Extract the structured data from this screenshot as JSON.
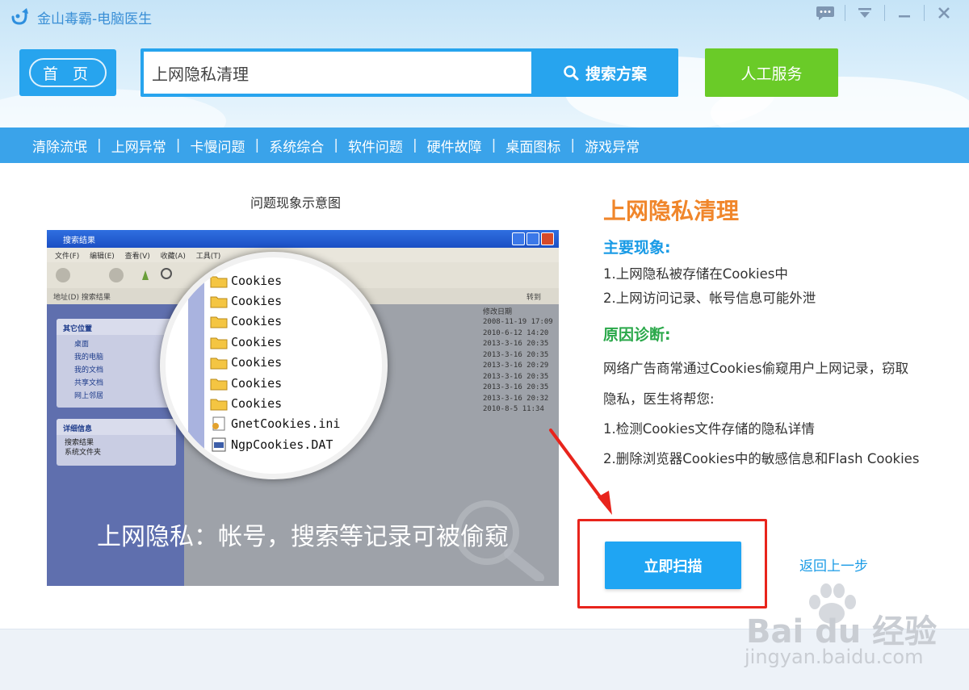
{
  "window": {
    "title": "金山毒霸-电脑医生",
    "brand_color": "#27a4ee"
  },
  "header": {
    "home_label": "首 页",
    "search_value": "上网隐私清理",
    "search_button": "搜索方案",
    "human_service": "人工服务"
  },
  "categories": [
    "清除流氓",
    "上网异常",
    "卡慢问题",
    "系统综合",
    "软件问题",
    "硬件故障",
    "桌面图标",
    "游戏异常"
  ],
  "diagram": {
    "caption": "问题现象示意图",
    "window_title": "搜索结果",
    "menu": "文件(F) 编辑(E) 查看(V) 收藏(A) 工具(T)",
    "address": "地址(D) 搜索结果",
    "go_label": "转到",
    "date_header": "修改日期",
    "dates": [
      "2008-11-19 17:09",
      "2010-6-12 14:20",
      "2013-3-16 20:35",
      "2013-3-16 20:35",
      "2013-3-16 20:29",
      "2013-3-16 20:35",
      "2013-3-16 20:35",
      "2013-3-16 20:32",
      "2010-8-5 11:34"
    ],
    "other_places": "其它位置",
    "other_items": [
      "桌面",
      "我的电脑",
      "我的文档",
      "共享文档",
      "网上邻居"
    ],
    "detail_title": "详细信息",
    "detail_items": [
      "搜索结果",
      "系统文件夹"
    ],
    "files": [
      "Cookies",
      "Cookies",
      "Cookies",
      "Cookies",
      "Cookies",
      "Cookies",
      "Cookies",
      "GnetCookies.ini",
      "NgpCookies.DAT"
    ],
    "overlay": "上网隐私：帐号，搜索等记录可被偷窥"
  },
  "issue": {
    "title": "上网隐私清理",
    "symptom_title": "主要现象:",
    "symptoms": [
      "1.上网隐私被存储在Cookies中",
      "2.上网访问记录、帐号信息可能外泄"
    ],
    "diag_title": "原因诊断:",
    "diag_lines": [
      "网络广告商常通过Cookies偷窥用户上网记录，窃取",
      "隐私，医生将帮您:",
      "1.检测Cookies文件存储的隐私详情",
      "2.删除浏览器Cookies中的敏感信息和Flash Cookies"
    ]
  },
  "actions": {
    "scan": "立即扫描",
    "back": "返回上一步"
  },
  "watermark": {
    "brand": "Bai du 经验",
    "url": "jingyan.baidu.com"
  }
}
